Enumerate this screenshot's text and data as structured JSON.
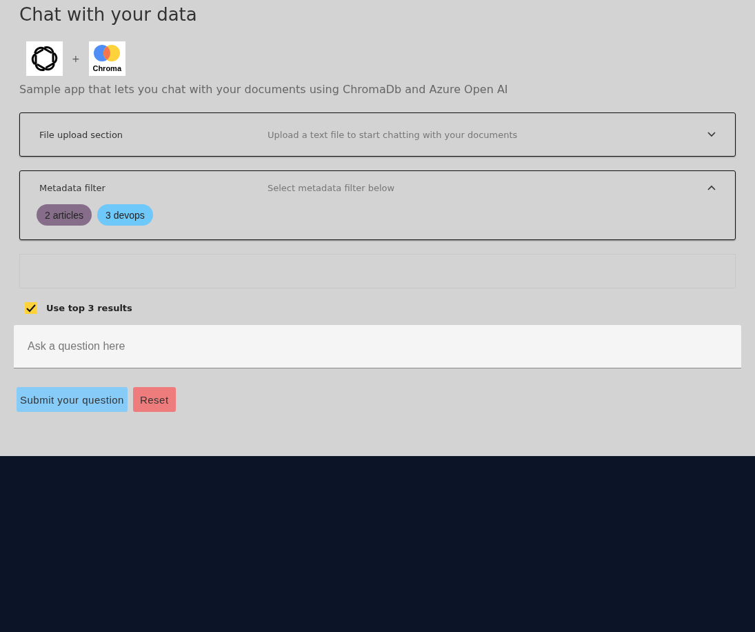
{
  "title": "Chat with your data",
  "logos": {
    "separator": "+",
    "chroma_label": "Chroma"
  },
  "subtitle": "Sample app that lets you chat with your documents using ChromaDb and Azure Open AI",
  "sections": [
    {
      "title": "File upload section",
      "description": "Upload a text file to start chatting with your documents",
      "expanded": false
    },
    {
      "title": "Metadata filter",
      "description": "Select metadata filter below",
      "expanded": true,
      "chips": [
        {
          "label": "2 articles",
          "color": "#866d8a"
        },
        {
          "label": "3 devops",
          "color": "#6ec8fa"
        }
      ]
    }
  ],
  "option": {
    "label": "Use top 3 results",
    "checked": true
  },
  "question": {
    "placeholder": "Ask a question here"
  },
  "buttons": [
    {
      "label": "Submit your question",
      "kind": "primary"
    },
    {
      "label": "Reset",
      "kind": "danger"
    }
  ]
}
